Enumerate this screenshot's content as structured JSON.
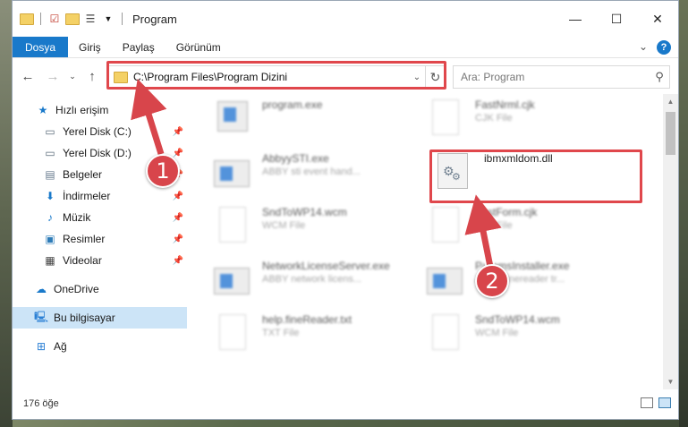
{
  "window": {
    "title": "Program",
    "controls": {
      "minimize": "—",
      "maximize": "☐",
      "close": "✕"
    }
  },
  "ribbon": {
    "tabs": [
      {
        "label": "Dosya",
        "active": true
      },
      {
        "label": "Giriş"
      },
      {
        "label": "Paylaş"
      },
      {
        "label": "Görünüm"
      }
    ],
    "expand_icon": "chevron-down-icon",
    "help_label": "?"
  },
  "nav": {
    "address": "C:\\Program Files\\Program Dizini",
    "search_placeholder": "Ara: Program"
  },
  "sidebar": {
    "items": [
      {
        "label": "Hızlı erişim",
        "icon": "star-icon"
      },
      {
        "label": "Yerel Disk (C:)",
        "icon": "drive-icon",
        "pinned": true
      },
      {
        "label": "Yerel Disk (D:)",
        "icon": "drive-icon",
        "pinned": true
      },
      {
        "label": "Belgeler",
        "icon": "documents-icon",
        "pinned": true
      },
      {
        "label": "İndirmeler",
        "icon": "download-icon",
        "pinned": true
      },
      {
        "label": "Müzik",
        "icon": "music-icon",
        "pinned": true
      },
      {
        "label": "Resimler",
        "icon": "pictures-icon",
        "pinned": true
      },
      {
        "label": "Videolar",
        "icon": "videos-icon",
        "pinned": true
      },
      {
        "label": "OneDrive",
        "icon": "cloud-icon"
      },
      {
        "label": "Bu bilgisayar",
        "icon": "computer-icon",
        "selected": true
      },
      {
        "label": "Ağ",
        "icon": "network-icon"
      }
    ]
  },
  "files": [
    {
      "name": "program.exe",
      "type": ""
    },
    {
      "name": "FastNrml.cjk",
      "type": "CJK File"
    },
    {
      "name": "AbbyySTI.exe",
      "type": "ABBY sti event hand..."
    },
    {
      "name": "ibmxmldom.dll",
      "type": ""
    },
    {
      "name": "SndToWP14.wcm",
      "type": "WCM File"
    },
    {
      "name": "FastForm.cjk",
      "type": "CJK File"
    },
    {
      "name": "NetworkLicenseServer.exe",
      "type": "ABBY network licens..."
    },
    {
      "name": "ParamsInstaller.exe",
      "type": "ABBY finereader tr..."
    },
    {
      "name": "help.fineReader.txt",
      "type": "TXT File"
    },
    {
      "name": "SndToWP14.wcm",
      "type": "WCM File"
    }
  ],
  "status": {
    "count": "176 öğe"
  },
  "annotations": {
    "badge1": "1",
    "badge2": "2"
  },
  "colors": {
    "accent": "#1979ca",
    "highlight": "#e0474c",
    "badge": "#d8454b"
  }
}
